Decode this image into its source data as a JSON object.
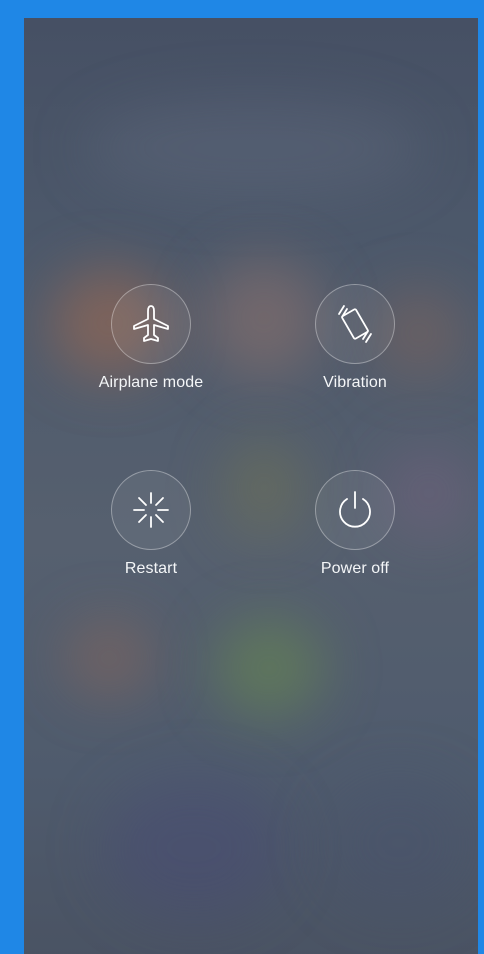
{
  "power_menu": {
    "items": [
      {
        "label": "Airplane mode",
        "icon": "airplane-icon"
      },
      {
        "label": "Vibration",
        "icon": "vibration-icon"
      },
      {
        "label": "Restart",
        "icon": "restart-icon"
      },
      {
        "label": "Power off",
        "icon": "power-icon"
      }
    ]
  },
  "colors": {
    "frame_border": "#1f87e6",
    "label_text": "#f4f6f8",
    "icon_stroke": "#ffffff"
  }
}
